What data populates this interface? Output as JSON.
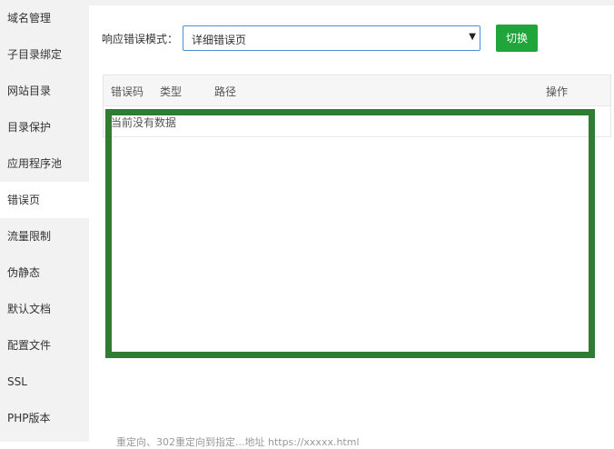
{
  "sidebar": {
    "items": [
      {
        "label": "域名管理"
      },
      {
        "label": "子目录绑定"
      },
      {
        "label": "网站目录"
      },
      {
        "label": "目录保护"
      },
      {
        "label": "应用程序池"
      },
      {
        "label": "错误页",
        "active": true
      },
      {
        "label": "流量限制"
      },
      {
        "label": "伪静态"
      },
      {
        "label": "默认文档"
      },
      {
        "label": "配置文件"
      },
      {
        "label": "SSL"
      },
      {
        "label": "PHP版本"
      }
    ]
  },
  "error_mode": {
    "label": "响应错误模式：",
    "selected": "详细错误页",
    "switch_label": "切换"
  },
  "table": {
    "columns": [
      "错误码",
      "类型",
      "路径",
      "操作"
    ],
    "empty_text": "当前没有数据"
  },
  "footnote": "重定向、302重定向到指定...地址 https://xxxxx.html"
}
